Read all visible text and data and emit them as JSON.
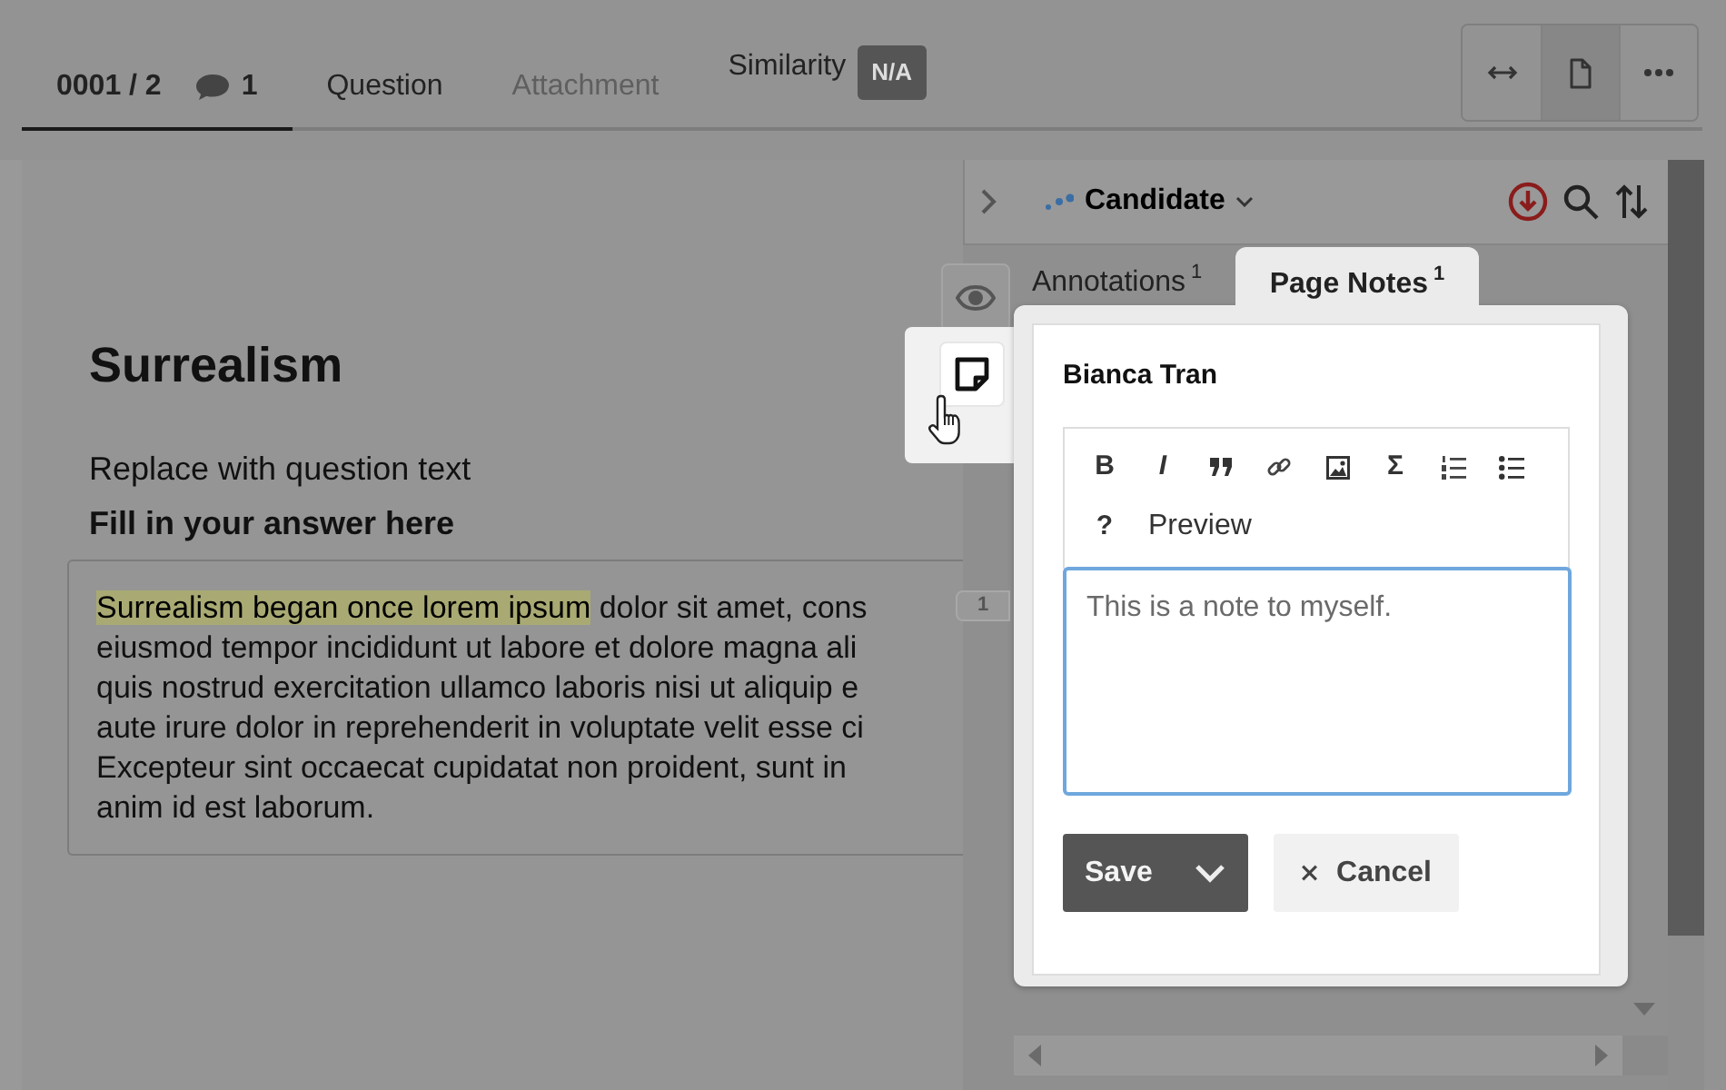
{
  "header_tabs": [
    {
      "label": "0001 / 2",
      "comment_count": "1",
      "selected": true,
      "disabled": false
    },
    {
      "label": "Question",
      "selected": false,
      "disabled": false
    },
    {
      "label": "Attachment",
      "selected": false,
      "disabled": true
    },
    {
      "label": "Similarity",
      "badge": "N/A",
      "selected": false,
      "disabled": false
    }
  ],
  "view_buttons": [
    {
      "kind": "width",
      "selected": false
    },
    {
      "kind": "page",
      "selected": true
    },
    {
      "kind": "more",
      "selected": false
    }
  ],
  "question": {
    "title": "Surrealism",
    "text": "Replace with question text",
    "prompt": "Fill in your answer here",
    "answer_lines": [
      {
        "highlighted": "Surrealism began once lorem ipsum",
        "text": " dolor sit amet, cons"
      },
      {
        "text": "eiusmod tempor incididunt ut labore et dolore magna ali"
      },
      {
        "text": "quis nostrud exercitation ullamco laboris nisi ut aliquip e"
      },
      {
        "text": "aute irure dolor in reprehenderit in voluptate velit esse ci"
      },
      {
        "text": "Excepteur sint occaecat cupidatat non proident, sunt in"
      },
      {
        "text": "anim id est laborum."
      }
    ],
    "annotation_marker": "1"
  },
  "side_panel": {
    "title": "Candidate",
    "rail": [
      {
        "kind": "view",
        "selected": false
      },
      {
        "kind": "notes",
        "selected": true
      }
    ],
    "tabs": [
      {
        "label": "Annotations",
        "count": "1",
        "selected": false
      },
      {
        "label": "Page Notes",
        "count": "1",
        "selected": true
      }
    ],
    "note": {
      "author": "Bianca Tran",
      "toolbar": [
        {
          "kind": "glyph",
          "label": "B"
        },
        {
          "kind": "glyph",
          "label": "I"
        },
        {
          "kind": "quote"
        },
        {
          "kind": "link"
        },
        {
          "kind": "image"
        },
        {
          "kind": "glyph",
          "label": "Σ"
        },
        {
          "kind": "ordered-list"
        },
        {
          "kind": "bullet-list"
        },
        {
          "kind": "glyph",
          "label": "?"
        },
        {
          "kind": "text",
          "label": "Preview"
        }
      ],
      "value": "This is a note to myself.",
      "save": "Save",
      "cancel": "Cancel"
    }
  }
}
